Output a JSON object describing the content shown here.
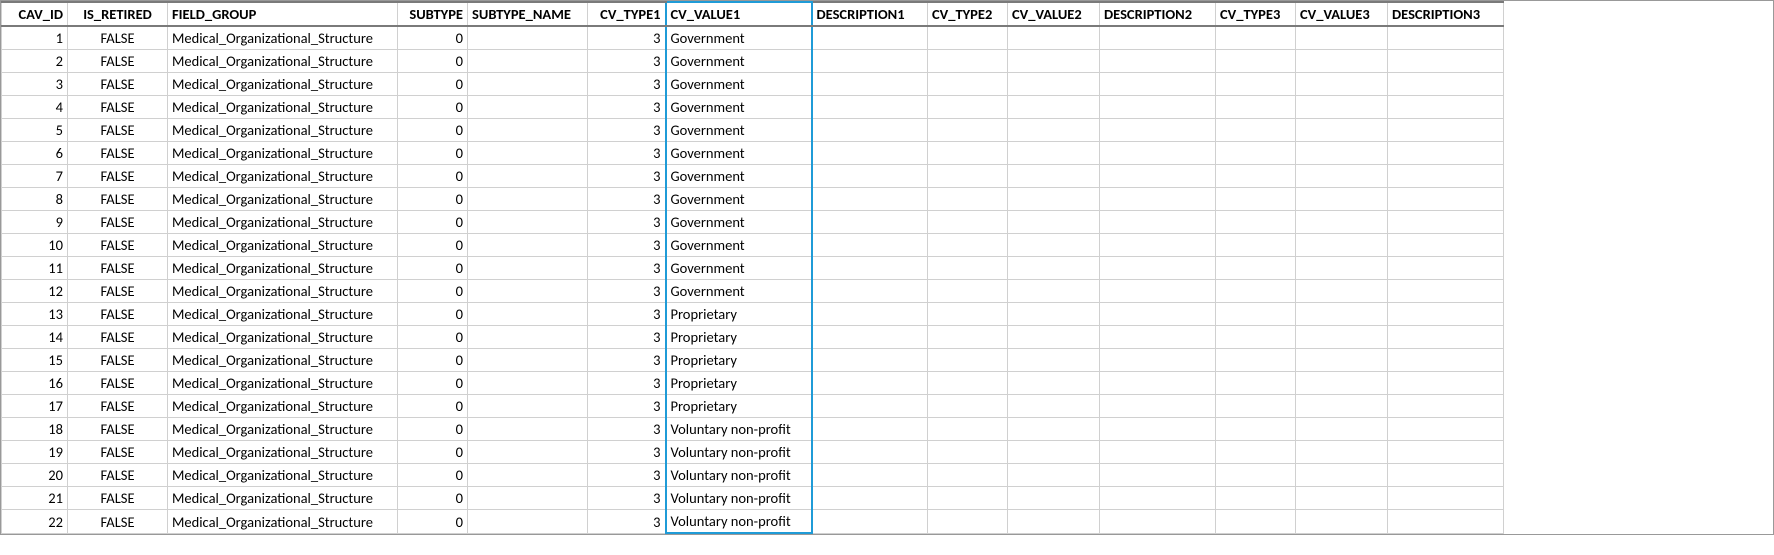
{
  "columns": {
    "cav_id": {
      "label": "CAV_ID",
      "align": "num",
      "selected": false
    },
    "is_retired": {
      "label": "IS_RETIRED",
      "align": "ctr",
      "selected": false
    },
    "field_group": {
      "label": "FIELD_GROUP",
      "align": "txt",
      "selected": false
    },
    "subtype": {
      "label": "SUBTYPE",
      "align": "num",
      "selected": false
    },
    "subtype_name": {
      "label": "SUBTYPE_NAME",
      "align": "txt",
      "selected": false
    },
    "cv_type1": {
      "label": "CV_TYPE1",
      "align": "num",
      "selected": false
    },
    "cv_value1": {
      "label": "CV_VALUE1",
      "align": "txt",
      "selected": true
    },
    "description1": {
      "label": "DESCRIPTION1",
      "align": "txt",
      "selected": false
    },
    "cv_type2": {
      "label": "CV_TYPE2",
      "align": "txt",
      "selected": false
    },
    "cv_value2": {
      "label": "CV_VALUE2",
      "align": "txt",
      "selected": false
    },
    "description2": {
      "label": "DESCRIPTION2",
      "align": "txt",
      "selected": false
    },
    "cv_type3": {
      "label": "CV_TYPE3",
      "align": "txt",
      "selected": false
    },
    "cv_value3": {
      "label": "CV_VALUE3",
      "align": "txt",
      "selected": false
    },
    "description3": {
      "label": "DESCRIPTION3",
      "align": "txt",
      "selected": false
    }
  },
  "column_order": [
    "cav_id",
    "is_retired",
    "field_group",
    "subtype",
    "subtype_name",
    "cv_type1",
    "cv_value1",
    "description1",
    "cv_type2",
    "cv_value2",
    "description2",
    "cv_type3",
    "cv_value3",
    "description3"
  ],
  "col_classes": {
    "cav_id": "c-cav",
    "is_retired": "c-ret",
    "field_group": "c-fg",
    "subtype": "c-sub",
    "subtype_name": "c-subn",
    "cv_type1": "c-t1",
    "cv_value1": "c-v1",
    "description1": "c-d1",
    "cv_type2": "c-t2",
    "cv_value2": "c-v2",
    "description2": "c-d2",
    "cv_type3": "c-t3",
    "cv_value3": "c-v3",
    "description3": "c-d3"
  },
  "rows": [
    {
      "cav_id": "1",
      "is_retired": "FALSE",
      "field_group": "Medical_Organizational_Structure",
      "subtype": "0",
      "subtype_name": "",
      "cv_type1": "3",
      "cv_value1": "Government",
      "description1": "",
      "cv_type2": "",
      "cv_value2": "",
      "description2": "",
      "cv_type3": "",
      "cv_value3": "",
      "description3": ""
    },
    {
      "cav_id": "2",
      "is_retired": "FALSE",
      "field_group": "Medical_Organizational_Structure",
      "subtype": "0",
      "subtype_name": "",
      "cv_type1": "3",
      "cv_value1": "Government",
      "description1": "",
      "cv_type2": "",
      "cv_value2": "",
      "description2": "",
      "cv_type3": "",
      "cv_value3": "",
      "description3": ""
    },
    {
      "cav_id": "3",
      "is_retired": "FALSE",
      "field_group": "Medical_Organizational_Structure",
      "subtype": "0",
      "subtype_name": "",
      "cv_type1": "3",
      "cv_value1": "Government",
      "description1": "",
      "cv_type2": "",
      "cv_value2": "",
      "description2": "",
      "cv_type3": "",
      "cv_value3": "",
      "description3": ""
    },
    {
      "cav_id": "4",
      "is_retired": "FALSE",
      "field_group": "Medical_Organizational_Structure",
      "subtype": "0",
      "subtype_name": "",
      "cv_type1": "3",
      "cv_value1": "Government",
      "description1": "",
      "cv_type2": "",
      "cv_value2": "",
      "description2": "",
      "cv_type3": "",
      "cv_value3": "",
      "description3": ""
    },
    {
      "cav_id": "5",
      "is_retired": "FALSE",
      "field_group": "Medical_Organizational_Structure",
      "subtype": "0",
      "subtype_name": "",
      "cv_type1": "3",
      "cv_value1": "Government",
      "description1": "",
      "cv_type2": "",
      "cv_value2": "",
      "description2": "",
      "cv_type3": "",
      "cv_value3": "",
      "description3": ""
    },
    {
      "cav_id": "6",
      "is_retired": "FALSE",
      "field_group": "Medical_Organizational_Structure",
      "subtype": "0",
      "subtype_name": "",
      "cv_type1": "3",
      "cv_value1": "Government",
      "description1": "",
      "cv_type2": "",
      "cv_value2": "",
      "description2": "",
      "cv_type3": "",
      "cv_value3": "",
      "description3": ""
    },
    {
      "cav_id": "7",
      "is_retired": "FALSE",
      "field_group": "Medical_Organizational_Structure",
      "subtype": "0",
      "subtype_name": "",
      "cv_type1": "3",
      "cv_value1": "Government",
      "description1": "",
      "cv_type2": "",
      "cv_value2": "",
      "description2": "",
      "cv_type3": "",
      "cv_value3": "",
      "description3": ""
    },
    {
      "cav_id": "8",
      "is_retired": "FALSE",
      "field_group": "Medical_Organizational_Structure",
      "subtype": "0",
      "subtype_name": "",
      "cv_type1": "3",
      "cv_value1": "Government",
      "description1": "",
      "cv_type2": "",
      "cv_value2": "",
      "description2": "",
      "cv_type3": "",
      "cv_value3": "",
      "description3": ""
    },
    {
      "cav_id": "9",
      "is_retired": "FALSE",
      "field_group": "Medical_Organizational_Structure",
      "subtype": "0",
      "subtype_name": "",
      "cv_type1": "3",
      "cv_value1": "Government",
      "description1": "",
      "cv_type2": "",
      "cv_value2": "",
      "description2": "",
      "cv_type3": "",
      "cv_value3": "",
      "description3": ""
    },
    {
      "cav_id": "10",
      "is_retired": "FALSE",
      "field_group": "Medical_Organizational_Structure",
      "subtype": "0",
      "subtype_name": "",
      "cv_type1": "3",
      "cv_value1": "Government",
      "description1": "",
      "cv_type2": "",
      "cv_value2": "",
      "description2": "",
      "cv_type3": "",
      "cv_value3": "",
      "description3": ""
    },
    {
      "cav_id": "11",
      "is_retired": "FALSE",
      "field_group": "Medical_Organizational_Structure",
      "subtype": "0",
      "subtype_name": "",
      "cv_type1": "3",
      "cv_value1": "Government",
      "description1": "",
      "cv_type2": "",
      "cv_value2": "",
      "description2": "",
      "cv_type3": "",
      "cv_value3": "",
      "description3": ""
    },
    {
      "cav_id": "12",
      "is_retired": "FALSE",
      "field_group": "Medical_Organizational_Structure",
      "subtype": "0",
      "subtype_name": "",
      "cv_type1": "3",
      "cv_value1": "Government",
      "description1": "",
      "cv_type2": "",
      "cv_value2": "",
      "description2": "",
      "cv_type3": "",
      "cv_value3": "",
      "description3": ""
    },
    {
      "cav_id": "13",
      "is_retired": "FALSE",
      "field_group": "Medical_Organizational_Structure",
      "subtype": "0",
      "subtype_name": "",
      "cv_type1": "3",
      "cv_value1": "Proprietary",
      "description1": "",
      "cv_type2": "",
      "cv_value2": "",
      "description2": "",
      "cv_type3": "",
      "cv_value3": "",
      "description3": ""
    },
    {
      "cav_id": "14",
      "is_retired": "FALSE",
      "field_group": "Medical_Organizational_Structure",
      "subtype": "0",
      "subtype_name": "",
      "cv_type1": "3",
      "cv_value1": "Proprietary",
      "description1": "",
      "cv_type2": "",
      "cv_value2": "",
      "description2": "",
      "cv_type3": "",
      "cv_value3": "",
      "description3": ""
    },
    {
      "cav_id": "15",
      "is_retired": "FALSE",
      "field_group": "Medical_Organizational_Structure",
      "subtype": "0",
      "subtype_name": "",
      "cv_type1": "3",
      "cv_value1": "Proprietary",
      "description1": "",
      "cv_type2": "",
      "cv_value2": "",
      "description2": "",
      "cv_type3": "",
      "cv_value3": "",
      "description3": ""
    },
    {
      "cav_id": "16",
      "is_retired": "FALSE",
      "field_group": "Medical_Organizational_Structure",
      "subtype": "0",
      "subtype_name": "",
      "cv_type1": "3",
      "cv_value1": "Proprietary",
      "description1": "",
      "cv_type2": "",
      "cv_value2": "",
      "description2": "",
      "cv_type3": "",
      "cv_value3": "",
      "description3": ""
    },
    {
      "cav_id": "17",
      "is_retired": "FALSE",
      "field_group": "Medical_Organizational_Structure",
      "subtype": "0",
      "subtype_name": "",
      "cv_type1": "3",
      "cv_value1": "Proprietary",
      "description1": "",
      "cv_type2": "",
      "cv_value2": "",
      "description2": "",
      "cv_type3": "",
      "cv_value3": "",
      "description3": ""
    },
    {
      "cav_id": "18",
      "is_retired": "FALSE",
      "field_group": "Medical_Organizational_Structure",
      "subtype": "0",
      "subtype_name": "",
      "cv_type1": "3",
      "cv_value1": "Voluntary non-profit",
      "description1": "",
      "cv_type2": "",
      "cv_value2": "",
      "description2": "",
      "cv_type3": "",
      "cv_value3": "",
      "description3": ""
    },
    {
      "cav_id": "19",
      "is_retired": "FALSE",
      "field_group": "Medical_Organizational_Structure",
      "subtype": "0",
      "subtype_name": "",
      "cv_type1": "3",
      "cv_value1": "Voluntary non-profit",
      "description1": "",
      "cv_type2": "",
      "cv_value2": "",
      "description2": "",
      "cv_type3": "",
      "cv_value3": "",
      "description3": ""
    },
    {
      "cav_id": "20",
      "is_retired": "FALSE",
      "field_group": "Medical_Organizational_Structure",
      "subtype": "0",
      "subtype_name": "",
      "cv_type1": "3",
      "cv_value1": "Voluntary non-profit",
      "description1": "",
      "cv_type2": "",
      "cv_value2": "",
      "description2": "",
      "cv_type3": "",
      "cv_value3": "",
      "description3": ""
    },
    {
      "cav_id": "21",
      "is_retired": "FALSE",
      "field_group": "Medical_Organizational_Structure",
      "subtype": "0",
      "subtype_name": "",
      "cv_type1": "3",
      "cv_value1": "Voluntary non-profit",
      "description1": "",
      "cv_type2": "",
      "cv_value2": "",
      "description2": "",
      "cv_type3": "",
      "cv_value3": "",
      "description3": ""
    },
    {
      "cav_id": "22",
      "is_retired": "FALSE",
      "field_group": "Medical_Organizational_Structure",
      "subtype": "0",
      "subtype_name": "",
      "cv_type1": "3",
      "cv_value1": "Voluntary non-profit",
      "description1": "",
      "cv_type2": "",
      "cv_value2": "",
      "description2": "",
      "cv_type3": "",
      "cv_value3": "",
      "description3": ""
    }
  ]
}
